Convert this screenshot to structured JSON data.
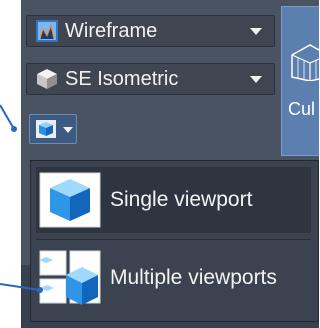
{
  "toolbar": {
    "visual_style": {
      "label": "Wireframe",
      "icon": "wireframe-style-icon"
    },
    "view": {
      "label": "SE Isometric",
      "icon": "isometric-cube-icon"
    },
    "viewport_button": {
      "icon": "viewport-cube-icon"
    },
    "side_tile": {
      "label": "Cul",
      "icon": "grid-cube-icon"
    }
  },
  "viewport_menu": {
    "items": [
      {
        "label": "Single viewport",
        "icon": "single-viewport-icon"
      },
      {
        "label": "Multiple viewports",
        "icon": "multiple-viewports-icon"
      }
    ]
  },
  "colors": {
    "panel": "#4a5361",
    "menu": "#3c4350",
    "accent_blue": "#3d9be9",
    "pointer_line": "#2a67c2"
  }
}
